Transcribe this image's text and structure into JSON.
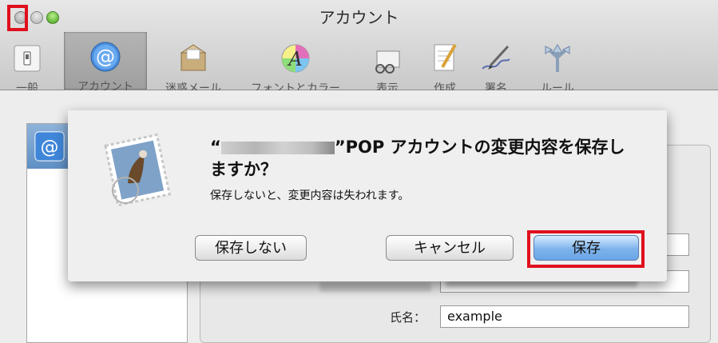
{
  "window": {
    "title": "アカウント"
  },
  "toolbar": {
    "items": [
      {
        "label": "一般",
        "icon": "general-switch-icon"
      },
      {
        "label": "アカウント",
        "icon": "at-sign-icon"
      },
      {
        "label": "迷惑メール",
        "icon": "junk-mail-icon"
      },
      {
        "label": "フォントとカラー",
        "icon": "fonts-colors-icon"
      },
      {
        "label": "表示",
        "icon": "viewing-icon"
      },
      {
        "label": "作成",
        "icon": "composing-icon"
      },
      {
        "label": "署名",
        "icon": "signature-icon"
      },
      {
        "label": "ルール",
        "icon": "rules-icon"
      }
    ],
    "active_index": 1
  },
  "dialog": {
    "heading_prefix": "“",
    "heading_suffix": "”POP アカウントの変更内容を保存し",
    "heading_line2": "ますか？",
    "message": "保存しないと、変更内容は失われます。",
    "buttons": {
      "dont_save": "保存しない",
      "cancel": "キャンセル",
      "save": "保存"
    }
  },
  "account_form": {
    "name_label": "氏名：",
    "name_value": "example"
  },
  "colors": {
    "highlight": "#e0101d",
    "default_button": "#6aa5e6",
    "selection": "#5f8fc4"
  }
}
